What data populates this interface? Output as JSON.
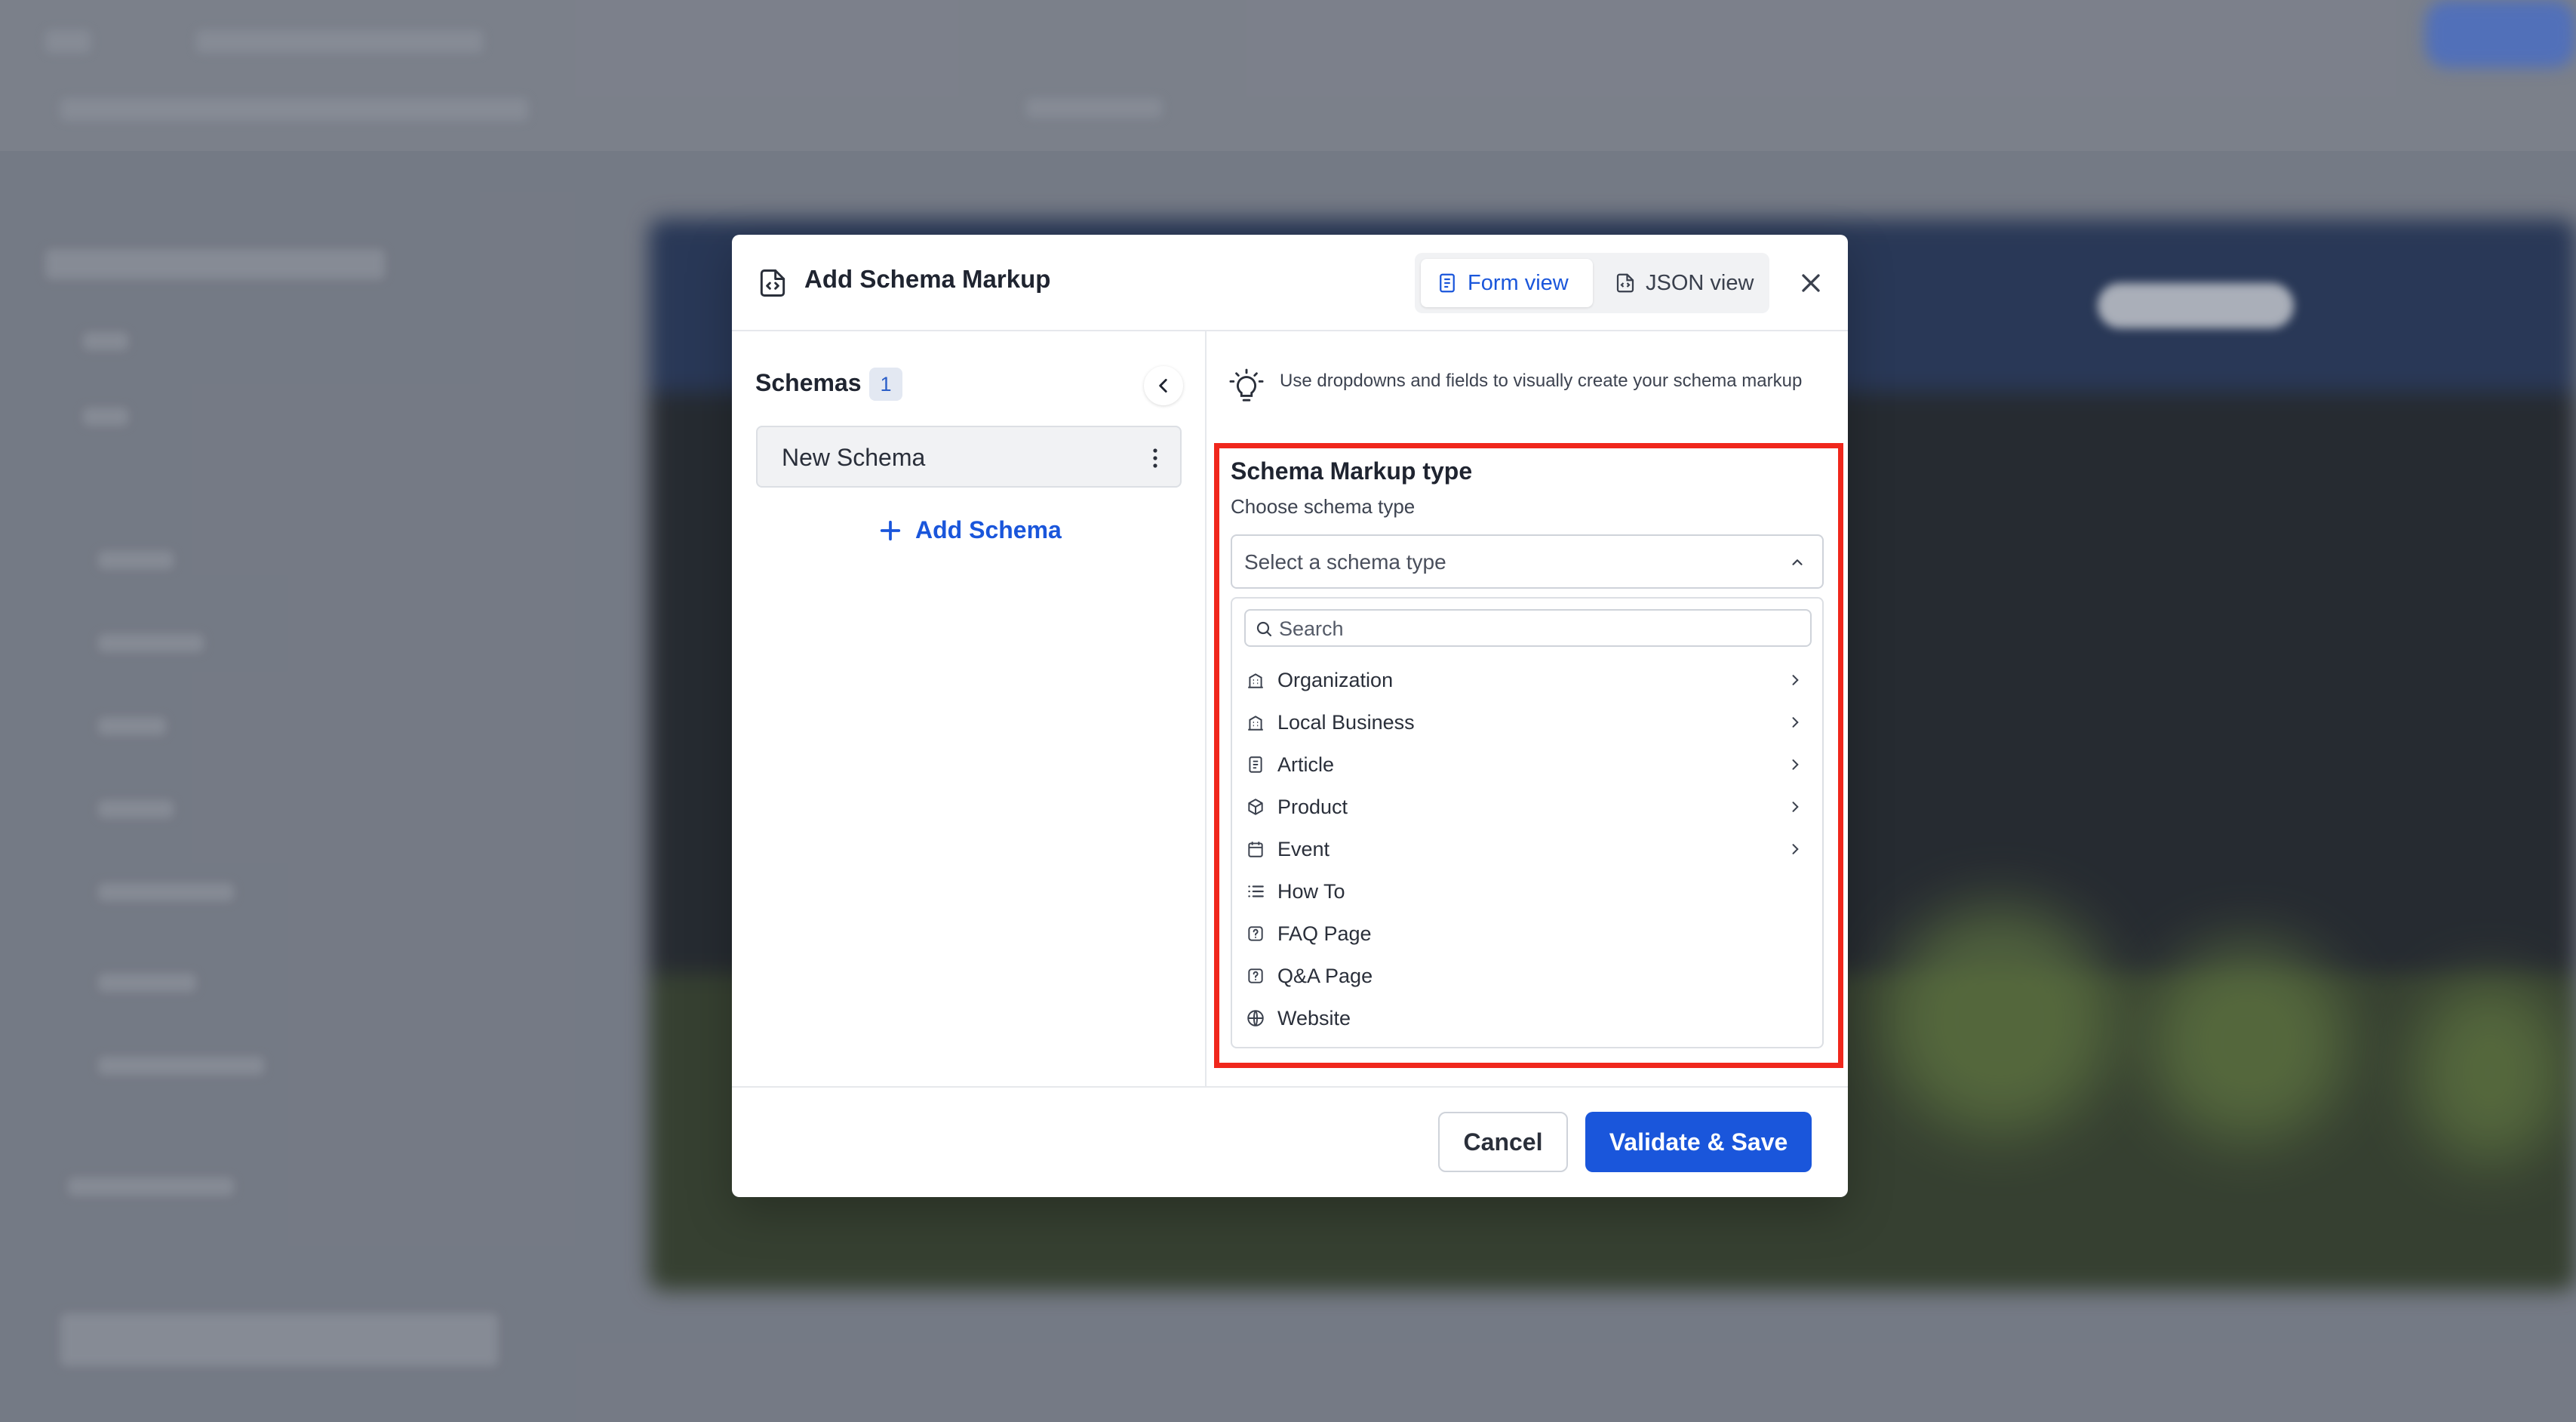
{
  "modal": {
    "title": "Add Schema Markup",
    "tabs": [
      {
        "label": "Form view",
        "icon": "document-icon",
        "active": true
      },
      {
        "label": "JSON view",
        "icon": "code-file-icon",
        "active": false
      }
    ]
  },
  "left_panel": {
    "heading": "Schemas",
    "count": "1",
    "schemas": [
      {
        "label": "New Schema"
      }
    ],
    "add_label": "Add Schema"
  },
  "right_panel": {
    "hint": "Use dropdowns and fields to visually create your schema markup",
    "field": {
      "label": "Schema Markup type",
      "sublabel": "Choose schema type",
      "placeholder": "Select a schema type"
    },
    "dropdown": {
      "search_placeholder": "Search",
      "options": [
        {
          "label": "Organization",
          "icon": "building-icon",
          "has_submenu": true
        },
        {
          "label": "Local Business",
          "icon": "building-icon",
          "has_submenu": true
        },
        {
          "label": "Article",
          "icon": "document-icon",
          "has_submenu": true
        },
        {
          "label": "Product",
          "icon": "box-icon",
          "has_submenu": true
        },
        {
          "label": "Event",
          "icon": "calendar-icon",
          "has_submenu": true
        },
        {
          "label": "How To",
          "icon": "list-icon",
          "has_submenu": false
        },
        {
          "label": "FAQ Page",
          "icon": "question-icon",
          "has_submenu": false
        },
        {
          "label": "Q&A Page",
          "icon": "question-icon",
          "has_submenu": false
        },
        {
          "label": "Website",
          "icon": "globe-icon",
          "has_submenu": false
        }
      ]
    }
  },
  "footer": {
    "cancel_label": "Cancel",
    "save_label": "Validate & Save"
  },
  "colors": {
    "accent": "#1a56db",
    "highlight": "#f0271c",
    "overlay": "#868b96"
  }
}
